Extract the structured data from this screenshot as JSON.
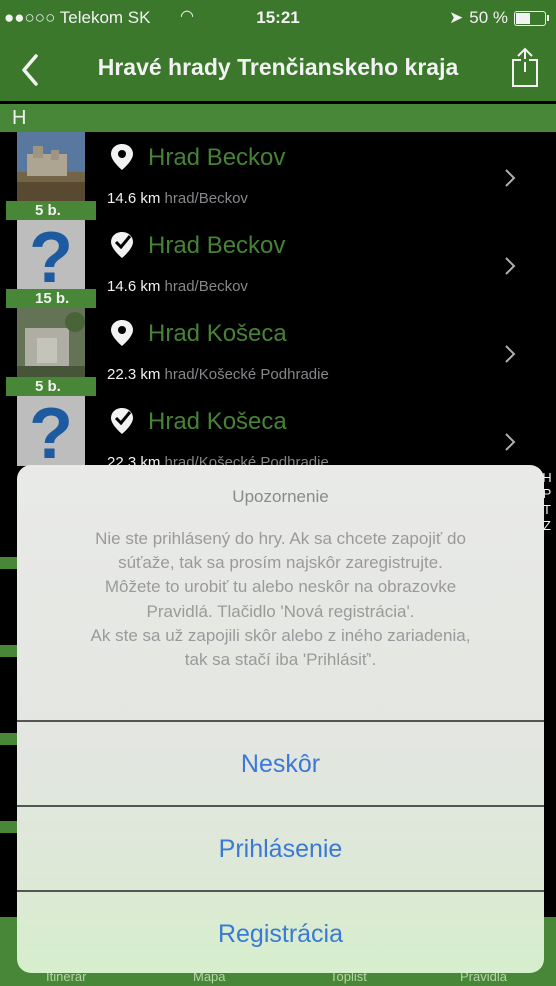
{
  "status_bar": {
    "carrier": "●●○○○ Telekom SK",
    "time": "15:21",
    "battery_text": "50 %"
  },
  "nav": {
    "title": "Hravé hrady Trenčianskeho kraja"
  },
  "section_letter": "H",
  "items": [
    {
      "title": "Hrad Beckov",
      "distance": "14.6 km",
      "path": "hrad/Beckov",
      "points": "5 b.",
      "thumb": "photo",
      "pin": "map-pin-icon"
    },
    {
      "title": "Hrad Beckov",
      "distance": "14.6 km",
      "path": "hrad/Beckov",
      "points": "15 b.",
      "thumb": "question",
      "pin": "map-pin-check-icon"
    },
    {
      "title": "Hrad Košeca",
      "distance": "22.3 km",
      "path": "hrad/Košecké Podhradie",
      "points": "5 b.",
      "thumb": "photo",
      "pin": "map-pin-icon"
    },
    {
      "title": "Hrad Košeca",
      "distance": "22.3 km",
      "path": "hrad/Košecké Podhradie",
      "points": "",
      "thumb": "question",
      "pin": "map-pin-check-icon"
    }
  ],
  "index_letters": [
    "H",
    "P",
    "T",
    "Z"
  ],
  "tabs": [
    "Itinerár",
    "Mapa",
    "Toplist",
    "Pravidlá"
  ],
  "alert": {
    "title": "Upozornenie",
    "message_lines": [
      "Nie ste prihlásený do hry. Ak sa chcete zapojiť do",
      "súťaže, tak sa prosím najskôr zaregistrujte.",
      "Môžete to urobiť tu alebo neskôr na obrazovke",
      "Pravidlá. Tlačidlo 'Nová registrácia'.",
      "Ak ste sa už zapojili skôr alebo z iného zariadenia,",
      "tak sa stačí iba 'Prihlásiť'."
    ],
    "buttons": [
      "Neskôr",
      "Prihlásenie",
      "Registrácia"
    ]
  },
  "colors": {
    "nav_green": "#3f7f2f",
    "accent_green": "#4c8f3a",
    "alert_button_blue": "#3a7ad6"
  }
}
